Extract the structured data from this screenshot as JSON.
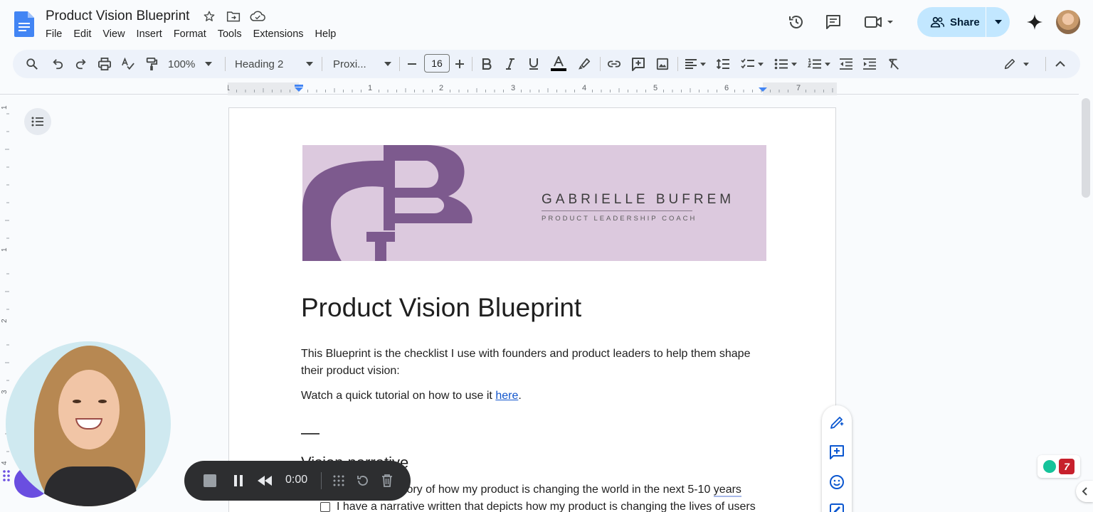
{
  "app": {
    "doc_title": "Product Vision Blueprint",
    "menu": [
      "File",
      "Edit",
      "View",
      "Insert",
      "Format",
      "Tools",
      "Extensions",
      "Help"
    ],
    "share_label": "Share"
  },
  "toolbar": {
    "zoom": "100%",
    "style": "Heading 2",
    "font": "Proxi...",
    "font_size": "16"
  },
  "ruler": {
    "h_marks": [
      "1",
      "1",
      "2",
      "3",
      "4",
      "5",
      "6",
      "7"
    ],
    "v_marks": [
      "1",
      "1",
      "2",
      "3",
      "4"
    ]
  },
  "document": {
    "banner_name": "GABRIELLE BUFREM",
    "banner_subtitle": "PRODUCT LEADERSHIP COACH",
    "banner_monogram": "GB",
    "heading": "Product Vision Blueprint",
    "intro": "This Blueprint is the checklist I use with founders and product leaders to help them shape their product vision:",
    "tutorial_prefix": "Watch a quick tutorial on how to use it ",
    "tutorial_link": "here",
    "tutorial_suffix": ".",
    "section_heading": "Vision narrative",
    "checklist_1_visible": "story of how my product is changing the world in the next 5-10 ",
    "checklist_1_flagged": "years",
    "checklist_2": "I have a narrative written that depicts how my product is changing the lives of users"
  },
  "recorder": {
    "time": "0:00"
  },
  "extensions": {
    "badge_number": "7"
  },
  "colors": {
    "accent": "#c2e7ff",
    "toolbar_bg": "#edf2fa",
    "link": "#1155cc",
    "banner_bg": "#dcc9de",
    "monogram": "#7d5a8e",
    "recorder_bg": "#2d2e30"
  }
}
